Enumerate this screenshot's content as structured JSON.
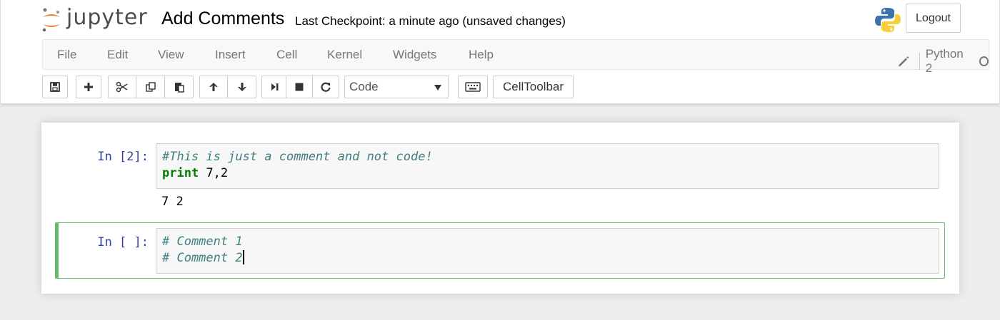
{
  "header": {
    "logo_text": "jupyter",
    "notebook_name": "Add Comments",
    "checkpoint": "Last Checkpoint: a minute ago (unsaved changes)",
    "logout_label": "Logout"
  },
  "menubar": {
    "items": [
      "File",
      "Edit",
      "View",
      "Insert",
      "Cell",
      "Kernel",
      "Widgets",
      "Help"
    ],
    "kernel_name": "Python 2"
  },
  "toolbar": {
    "buttons": [
      "save-icon",
      "add-cell-icon",
      "cut-icon",
      "copy-icon",
      "paste-icon",
      "move-up-icon",
      "move-down-icon",
      "run-icon",
      "stop-icon",
      "restart-icon",
      "keyboard-icon"
    ],
    "cell_type": "Code",
    "celltoolbar_label": "CellToolbar"
  },
  "cells": [
    {
      "prompt": "In [2]:",
      "code": [
        "#This is just a comment and not code!",
        "print 7,2"
      ],
      "output": "7 2"
    },
    {
      "prompt": "In [ ]:",
      "code": [
        "# Comment 1",
        "# Comment 2"
      ]
    }
  ],
  "colors": {
    "accent_orange": "#f37726",
    "selected_border": "#66bb6a",
    "prompt": "#303f9f",
    "comment": "#408080",
    "keyword": "#008000"
  }
}
